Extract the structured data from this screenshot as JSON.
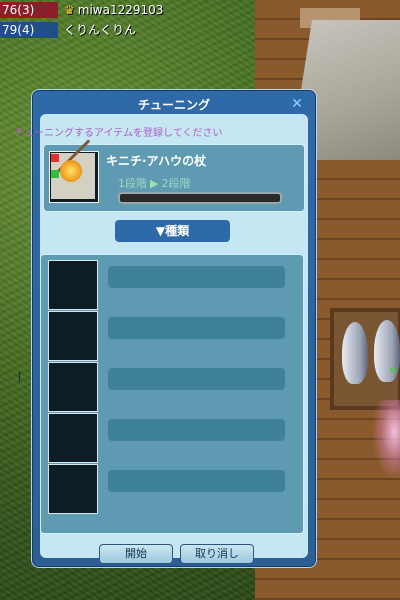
{
  "status": {
    "row1": {
      "hp": "76(3)",
      "player": "miwa1229103"
    },
    "row2": {
      "hp": "79(4)",
      "player": "くりんくりん"
    }
  },
  "window": {
    "title": "チューニング",
    "close_icon": "close-icon",
    "instruction": "チューニングするアイテムを登録してください",
    "item": {
      "name": "キニチ·アハウの杖",
      "stage_from": "1段階",
      "stage_to": "2段階",
      "arrow": "▶"
    },
    "type_button": "▼種類",
    "list_rows": 5,
    "buttons": {
      "start": "開始",
      "cancel": "取り消し"
    }
  },
  "colors": {
    "window_blue": "#2f6aa8",
    "panel_teal": "#5e9bb2",
    "inner_bg": "#c5e6f3",
    "instruction_purple": "#b15ec4"
  }
}
